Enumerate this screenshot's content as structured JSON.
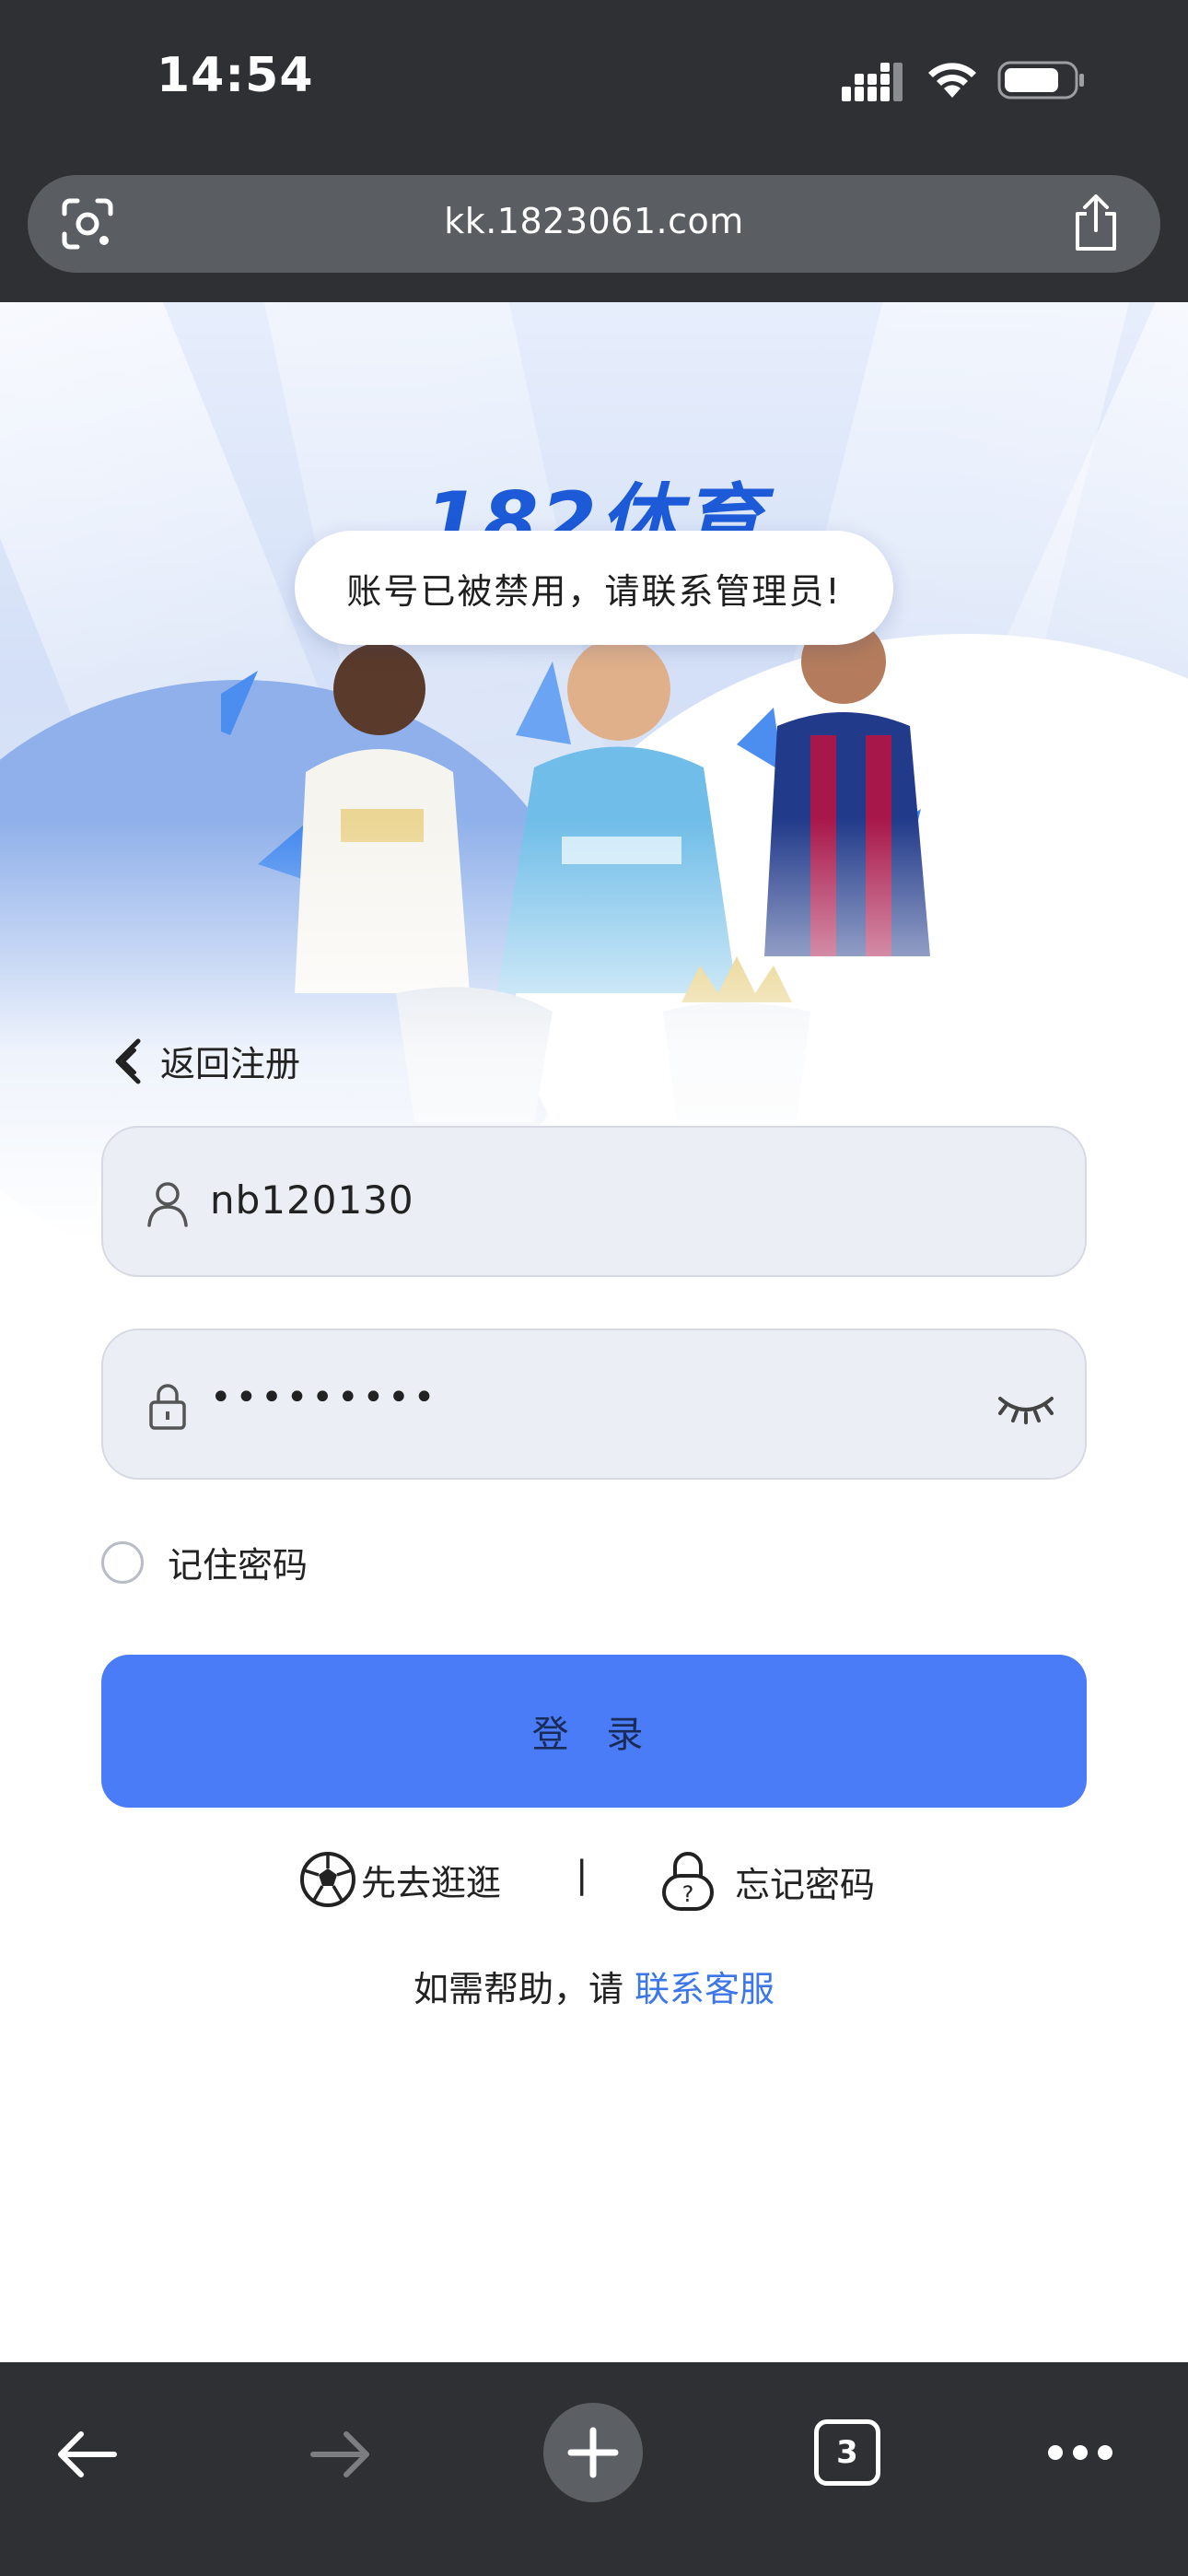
{
  "status_bar": {
    "time": "14:54"
  },
  "browser": {
    "url": "kk.1823061.com",
    "tab_count": "3"
  },
  "hero": {
    "logo_text": "182体育"
  },
  "toast": {
    "message": "账号已被禁用，请联系管理员!"
  },
  "login": {
    "back_label": "返回注册",
    "username_value": "nb120130",
    "password_value": "•••••••••",
    "remember_label": "记住密码",
    "submit_label": "登 录",
    "browse_label": "先去逛逛",
    "separator": "|",
    "forgot_label": "忘记密码",
    "help_prefix": "如需帮助，请 ",
    "help_link": "联系客服"
  },
  "colors": {
    "accent": "#4a7cf7",
    "link": "#3d76e6",
    "chrome_bg": "#2f3033"
  }
}
